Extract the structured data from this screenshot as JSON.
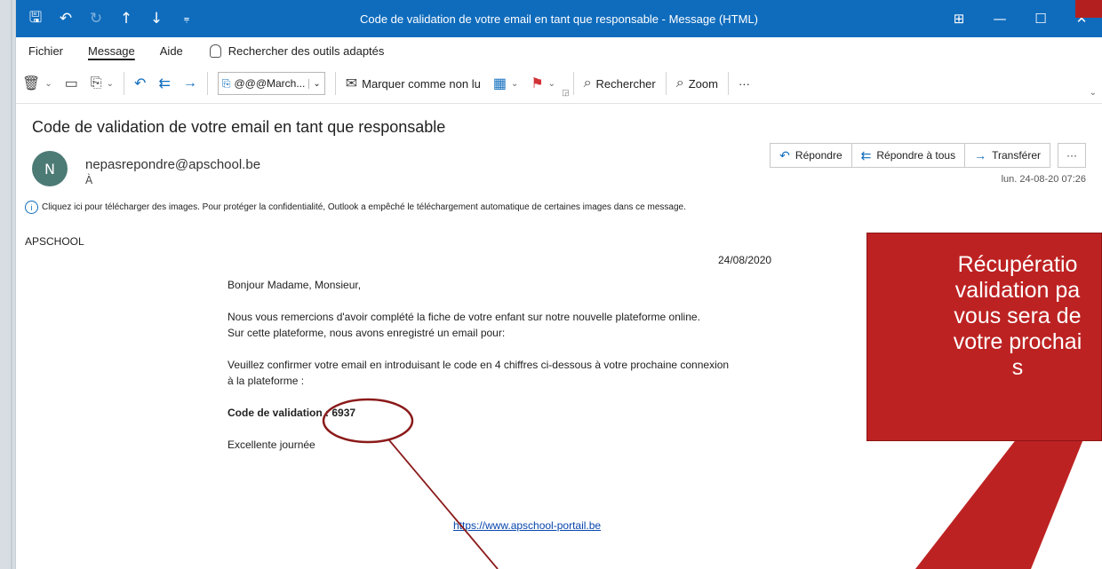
{
  "window": {
    "title": "Code de validation de votre email en tant que responsable  -  Message (HTML)",
    "controls": [
      "⊞",
      "—",
      "☐",
      "✕"
    ]
  },
  "tabs": {
    "file": "Fichier",
    "message": "Message",
    "help": "Aide",
    "search": "Rechercher des outils adaptés"
  },
  "toolbar": {
    "move_target": "@@@March...",
    "mark_unread": "Marquer comme non lu",
    "find": "Rechercher",
    "zoom": "Zoom",
    "more": "···"
  },
  "message": {
    "subject": "Code de validation de votre email en tant que responsable",
    "avatar_initial": "N",
    "sender": "nepasrepondre@apschool.be",
    "to_label": "À",
    "timestamp": "lun. 24-08-20 07:26",
    "reply": "Répondre",
    "reply_all": "Répondre à tous",
    "forward": "Transférer",
    "info": "Cliquez ici pour télécharger des images. Pour protéger la confidentialité, Outlook a empêché le téléchargement automatique de certaines images dans ce message."
  },
  "body": {
    "org": "APSCHOOL",
    "date": "24/08/2020",
    "greeting": "Bonjour Madame, Monsieur,",
    "line1": "Nous vous remercions d'avoir complété la fiche de votre enfant sur notre nouvelle plateforme online.",
    "line2": "Sur cette plateforme, nous avons enregistré un email pour:",
    "line3": "Veuillez confirmer votre email en introduisant le code en 4 chiffres ci-dessous à votre prochaine connexion",
    "line4": "à la plateforme :",
    "code_label": "Code de validation : 6937",
    "closing": "Excellente journée",
    "link": "https://www.apschool-portail.be"
  },
  "annotation": {
    "text": "Récupératio\nvalidation pa\nvous sera de\nvotre prochai\ns"
  },
  "colors": {
    "titlebar": "#0f6cbd",
    "callout": "#bd2222",
    "avatar": "#4c7a75",
    "annotation_line": "#8b1a1a"
  }
}
